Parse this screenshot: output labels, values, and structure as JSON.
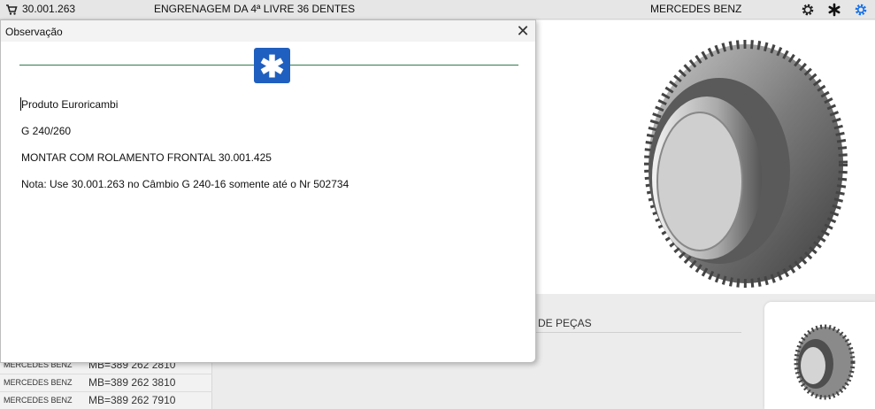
{
  "topbar": {
    "code": "30.001.263",
    "description": "ENGRENAGEM DA 4ª LIVRE 36 DENTES",
    "brand": "MERCEDES BENZ",
    "icons": [
      "cart-icon",
      "gear-icon",
      "asterisk-icon",
      "cog-settings-icon"
    ]
  },
  "modal": {
    "title": "Observação",
    "close": "✕",
    "asterisk": "✱",
    "lines": [
      "Produto Euroricambi",
      "G 240/260",
      "MONTAR COM ROLAMENTO FRONTAL 30.001.425",
      "Nota: Use 30.001.263 no Câmbio G 240-16 somente até o Nr 502734"
    ]
  },
  "section": {
    "title": "DE PEÇAS"
  },
  "references": [
    {
      "brand": "MERCEDES BENZ",
      "number": "MB=389 262 2810"
    },
    {
      "brand": "MERCEDES BENZ",
      "number": "MB=389 262 3810"
    },
    {
      "brand": "MERCEDES BENZ",
      "number": "MB=389 262 7910"
    }
  ],
  "colors": {
    "accent": "#1f5fbf",
    "divider": "#2e7d4e",
    "watermark": "#7fc9c3"
  }
}
